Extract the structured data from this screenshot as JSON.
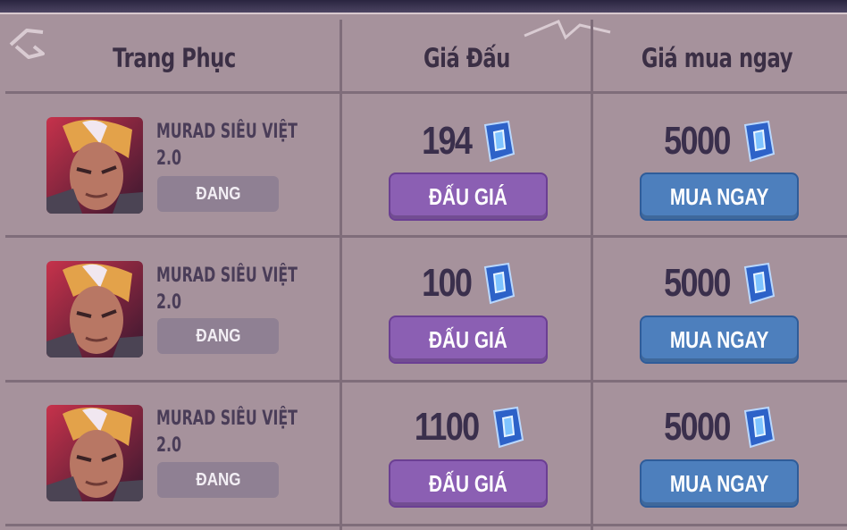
{
  "table": {
    "headers": {
      "skin": "Trang Phục",
      "bid_price": "Giá Đấu",
      "buy_now_price": "Giá mua ngay"
    },
    "rows": [
      {
        "skin_name_line1": "MURAD SIÊU VIỆT",
        "skin_name_line2": "2.0",
        "status": "ĐANG",
        "bid_price": "194",
        "buy_now_price": "5000",
        "bid_label": "ĐẤU GIÁ",
        "buy_label": "MUA NGAY"
      },
      {
        "skin_name_line1": "MURAD SIÊU VIỆT",
        "skin_name_line2": "2.0",
        "status": "ĐANG",
        "bid_price": "100",
        "buy_now_price": "5000",
        "bid_label": "ĐẤU GIÁ",
        "buy_label": "MUA NGAY"
      },
      {
        "skin_name_line1": "MURAD SIÊU VIỆT",
        "skin_name_line2": "2.0",
        "status": "ĐANG",
        "bid_price": "1100",
        "buy_now_price": "5000",
        "bid_label": "ĐẤU GIÁ",
        "buy_label": "MUA NGAY"
      }
    ]
  },
  "icons": {
    "currency": "quan-huy-gem-icon",
    "avatar": "murad-avatar"
  },
  "colors": {
    "panel": "#a6929c",
    "bid_button": "#8b5fb3",
    "buy_button": "#4d7fbd",
    "text_dark": "#3a2f4c"
  }
}
